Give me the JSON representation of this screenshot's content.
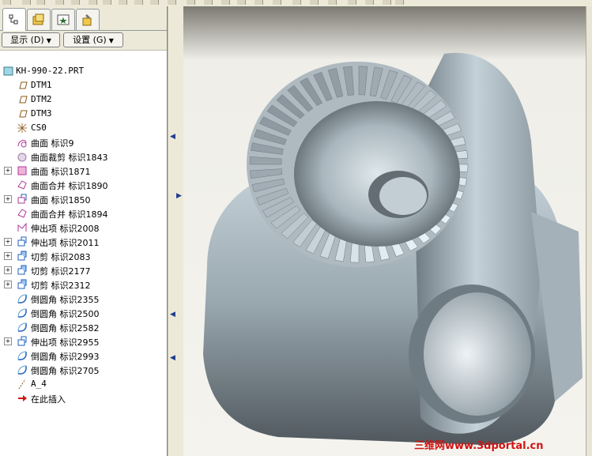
{
  "toolbar": {
    "display_label": "显示 (D)",
    "settings_label": "设置 (G)"
  },
  "tree": {
    "root": "KH-990-22.PRT",
    "items": [
      {
        "label": "DTM1",
        "icon": "datum-plane-icon",
        "expand": false
      },
      {
        "label": "DTM2",
        "icon": "datum-plane-icon",
        "expand": false
      },
      {
        "label": "DTM3",
        "icon": "datum-plane-icon",
        "expand": false
      },
      {
        "label": "CS0",
        "icon": "coordinate-system-icon",
        "expand": false
      },
      {
        "label": "曲面 标识9",
        "icon": "surface-icon",
        "expand": false
      },
      {
        "label": "曲面裁剪 标识1843",
        "icon": "surface-trim-icon",
        "expand": false
      },
      {
        "label": "曲面 标识1871",
        "icon": "surface-pink-icon",
        "expand": true
      },
      {
        "label": "曲面合并 标识1890",
        "icon": "surface-merge-icon",
        "expand": false
      },
      {
        "label": "曲面 标识1850",
        "icon": "surface-extrude-icon",
        "expand": true
      },
      {
        "label": "曲面合并 标识1894",
        "icon": "surface-merge-icon",
        "expand": false
      },
      {
        "label": "伸出项 标识2008",
        "icon": "protrusion-icon",
        "expand": false
      },
      {
        "label": "伸出项 标识2011",
        "icon": "extrude-icon",
        "expand": true
      },
      {
        "label": "切剪 标识2083",
        "icon": "cut-icon",
        "expand": true
      },
      {
        "label": "切剪 标识2177",
        "icon": "cut-icon",
        "expand": true
      },
      {
        "label": "切剪 标识2312",
        "icon": "cut-icon",
        "expand": true
      },
      {
        "label": "倒圆角 标识2355",
        "icon": "round-icon",
        "expand": false
      },
      {
        "label": "倒圆角 标识2500",
        "icon": "round-icon",
        "expand": false
      },
      {
        "label": "倒圆角 标识2582",
        "icon": "round-icon",
        "expand": false
      },
      {
        "label": "伸出项 标识2955",
        "icon": "extrude-icon",
        "expand": true
      },
      {
        "label": "倒圆角 标识2993",
        "icon": "round-icon",
        "expand": false
      },
      {
        "label": "倒圆角 标识2705",
        "icon": "round-icon",
        "expand": false
      },
      {
        "label": "A_4",
        "icon": "axis-icon",
        "expand": false
      },
      {
        "label": "在此插入",
        "icon": "insert-here-icon",
        "expand": false
      }
    ]
  },
  "watermark": "三维网www.3dportal.cn",
  "colors": {
    "accent": "#1f3c8f",
    "model": "#b9c6cf",
    "watermark": "#d01414"
  }
}
